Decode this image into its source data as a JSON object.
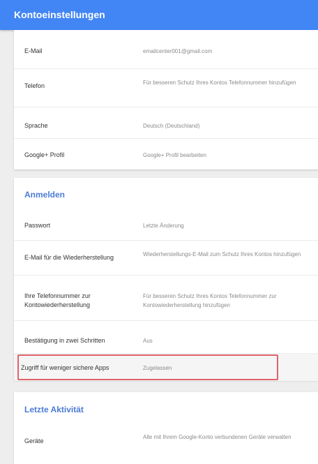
{
  "header": {
    "title": "Kontoeinstellungen"
  },
  "account": {
    "rows": [
      {
        "label": "E-Mail",
        "value": "emailcenter001@gmail.com"
      },
      {
        "label": "Telefon",
        "value": "Für besseren Schutz Ihres Kontos Telefonnummer hinzufügen"
      },
      {
        "label": "Sprache",
        "value": "Deutsch (Deutschland)"
      },
      {
        "label": "Google+ Profil",
        "value": "Google+ Profil bearbeiten"
      }
    ]
  },
  "signin": {
    "title": "Anmelden",
    "rows": [
      {
        "label": "Passwort",
        "value": "Letzte Änderung"
      },
      {
        "label": "E-Mail für die Wiederherstellung",
        "value": "Wiederherstellungs-E-Mail zum Schutz Ihres Kontos hinzufügen"
      },
      {
        "label": "Ihre Telefonnummer zur Kontowiederherstellung",
        "value": "Für besseren Schutz Ihres Kontos Telefonnummer zur Kontowiederherstellung hinzufügen"
      },
      {
        "label": "Bestätigung in zwei Schritten",
        "value": "Aus"
      },
      {
        "label": "Zugriff für weniger sichere Apps",
        "value": "Zugelassen"
      }
    ]
  },
  "activity": {
    "title": "Letzte Aktivität",
    "rows": [
      {
        "label": "Geräte",
        "value": "Alle mit Ihrem Google-Konto verbundenen Geräte verwalten"
      }
    ]
  },
  "colors": {
    "header_bg": "#4285f4",
    "section_title": "#4a7bd6",
    "highlight_border": "#e0626a"
  }
}
